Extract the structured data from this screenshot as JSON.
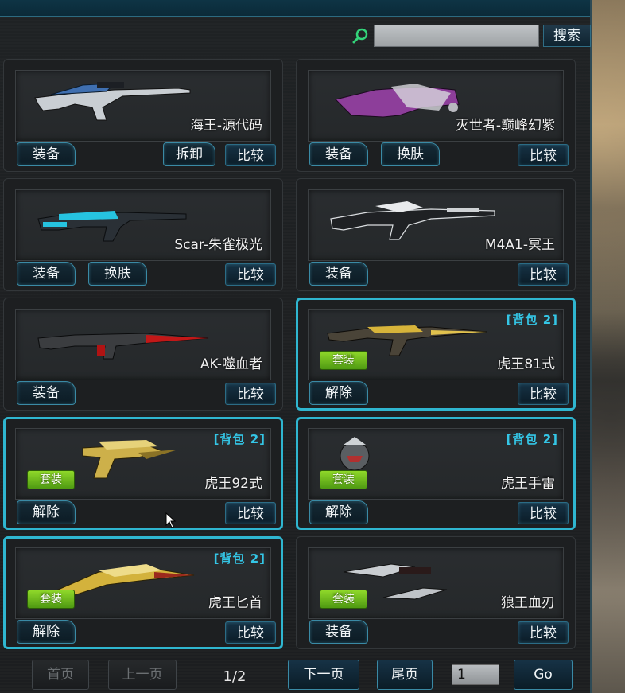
{
  "search": {
    "value": "",
    "button_label": "搜索"
  },
  "cards": [
    {
      "name": "海王-源代码",
      "buttons": [
        "装备",
        "拆卸"
      ],
      "compare": "比较",
      "bag": "",
      "set": ""
    },
    {
      "name": "灭世者-巅峰幻紫",
      "buttons": [
        "装备",
        "换肤"
      ],
      "compare": "比较",
      "bag": "",
      "set": ""
    },
    {
      "name": "Scar-朱雀极光",
      "buttons": [
        "装备",
        "换肤"
      ],
      "compare": "比较",
      "bag": "",
      "set": ""
    },
    {
      "name": "M4A1-冥王",
      "buttons": [
        "装备"
      ],
      "compare": "比较",
      "bag": "",
      "set": ""
    },
    {
      "name": "AK-噬血者",
      "buttons": [
        "装备"
      ],
      "compare": "比较",
      "bag": "",
      "set": ""
    },
    {
      "name": "虎王81式",
      "buttons": [
        "解除"
      ],
      "compare": "比较",
      "bag": "[背包 2]",
      "set": "套装"
    },
    {
      "name": "虎王92式",
      "buttons": [
        "解除"
      ],
      "compare": "比较",
      "bag": "[背包 2]",
      "set": "套装"
    },
    {
      "name": "虎王手雷",
      "buttons": [
        "解除"
      ],
      "compare": "比较",
      "bag": "[背包 2]",
      "set": "套装"
    },
    {
      "name": "虎王匕首",
      "buttons": [
        "解除"
      ],
      "compare": "比较",
      "bag": "[背包 2]",
      "set": "套装"
    },
    {
      "name": "狼王血刃",
      "buttons": [
        "装备"
      ],
      "compare": "比较",
      "bag": "",
      "set": "套装"
    }
  ],
  "pagination": {
    "first": "首页",
    "prev": "上一页",
    "page": "1/2",
    "next": "下一页",
    "last": "尾页",
    "input_value": "1",
    "go": "Go"
  },
  "colors": {
    "highlight": "#2fb6d0",
    "set_badge": "#6fbf1e",
    "bag_tag": "#34c6e6"
  }
}
